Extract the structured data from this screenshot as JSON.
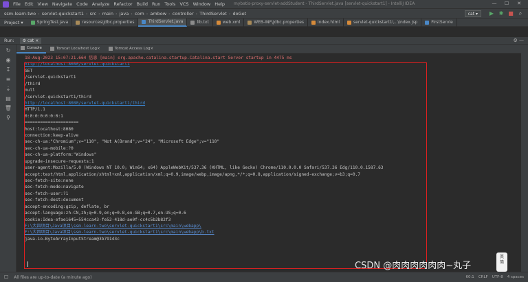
{
  "menubar": {
    "items": [
      "File",
      "Edit",
      "View",
      "Navigate",
      "Code",
      "Analyze",
      "Refactor",
      "Build",
      "Run",
      "Tools",
      "VCS",
      "Window",
      "Help"
    ],
    "window_title": "mybatis-proxy-servlet-addStudent - ThirdServlet.java [servlet-quickstart1] - IntelliJ IDEA"
  },
  "navbar": {
    "breadcrumbs": [
      "ssm-learn-two",
      "servlet-quickstart1",
      "src",
      "main",
      "java",
      "com",
      "ambow",
      "controller",
      "ThirdServlet",
      "doGet"
    ],
    "run_config": "cat"
  },
  "tabbar": {
    "project_label": "Project",
    "tabs": [
      {
        "label": "SpringTest.java",
        "color": "#59a869",
        "active": false
      },
      {
        "label": "resources\\jdbc.properties",
        "color": "#a88a59",
        "active": false
      },
      {
        "label": "ThirdServlet.java",
        "color": "#4a88c7",
        "active": true
      },
      {
        "label": "lib.txt",
        "color": "#8c8c8c",
        "active": false
      },
      {
        "label": "web.xml",
        "color": "#d78b3a",
        "active": false
      },
      {
        "label": "WEB-INF\\jdbc.properties",
        "color": "#a88a59",
        "active": false
      },
      {
        "label": "index.html",
        "color": "#d78b3a",
        "active": false
      },
      {
        "label": "servlet-quickstart1\\...\\index.jsp",
        "color": "#d78b3a",
        "active": false
      },
      {
        "label": "FirstServle",
        "color": "#4a88c7",
        "active": false
      }
    ]
  },
  "runbar": {
    "label": "Run:",
    "tab": "cat"
  },
  "consolebar": {
    "tabs": [
      "Console",
      "Tomcat Localhost Log",
      "Tomcat Access Log"
    ]
  },
  "console": {
    "lines": [
      {
        "text": "18-Aug-2023 15:07:21.664 信息 [main] org.apache.catalina.startup.Catalina.start Server startup in 4475 ms",
        "kind": "err"
      },
      {
        "text": "http://localhost:8080/servlet-quickstart1",
        "kind": "link"
      },
      {
        "text": "GET",
        "kind": "plain"
      },
      {
        "text": "/servlet-quickstart1",
        "kind": "plain"
      },
      {
        "text": "/third",
        "kind": "plain"
      },
      {
        "text": "null",
        "kind": "plain"
      },
      {
        "text": "/servlet-quickstart1/third",
        "kind": "plain"
      },
      {
        "text": "http://localhost:8080/servlet-quickstart1/third",
        "kind": "link"
      },
      {
        "text": "HTTP/1.1",
        "kind": "plain"
      },
      {
        "text": "0:0:0:0:0:0:0:1",
        "kind": "plain"
      },
      {
        "text": "=====================",
        "kind": "plain"
      },
      {
        "text": "host:localhost:8080",
        "kind": "plain"
      },
      {
        "text": "connection:keep-alive",
        "kind": "plain"
      },
      {
        "text": "sec-ch-ua:\"Chromium\";v=\"110\", \"Not A(Brand\";v=\"24\", \"Microsoft Edge\";v=\"110\"",
        "kind": "plain"
      },
      {
        "text": "sec-ch-ua-mobile:?0",
        "kind": "plain"
      },
      {
        "text": "sec-ch-ua-platform:\"Windows\"",
        "kind": "plain"
      },
      {
        "text": "upgrade-insecure-requests:1",
        "kind": "plain"
      },
      {
        "text": "user-agent:Mozilla/5.0 (Windows NT 10.0; Win64; x64) AppleWebKit/537.36 (KHTML, like Gecko) Chrome/110.0.0.0 Safari/537.36 Edg/110.0.1587.63",
        "kind": "plain"
      },
      {
        "text": "accept:text/html,application/xhtml+xml,application/xml;q=0.9,image/webp,image/apng,*/*;q=0.8,application/signed-exchange;v=b3;q=0.7",
        "kind": "plain"
      },
      {
        "text": "sec-fetch-site:none",
        "kind": "plain"
      },
      {
        "text": "sec-fetch-mode:navigate",
        "kind": "plain"
      },
      {
        "text": "sec-fetch-user:?1",
        "kind": "plain"
      },
      {
        "text": "sec-fetch-dest:document",
        "kind": "plain"
      },
      {
        "text": "accept-encoding:gzip, deflate, br",
        "kind": "plain"
      },
      {
        "text": "accept-language:zh-CN,zh;q=0.9,en;q=0.8,en-GB;q=0.7,en-US;q=0.6",
        "kind": "plain"
      },
      {
        "text": "cookie:Idea-efae1645=554cca43-fe52-418d-ae0f-cc4c5b2b82f3",
        "kind": "plain"
      },
      {
        "text": "F:\\大四项目\\Java项目\\ssm-learn-two\\servlet-quickstart1\\src\\main\\webapp\\",
        "kind": "path"
      },
      {
        "text": "F:\\大四项目\\Java项目\\ssm-learn-two\\servlet-quickstart1\\src\\main\\webapp\\b.txt",
        "kind": "path"
      },
      {
        "text": "java.io.ByteArrayInputStream@3b79143c",
        "kind": "plain"
      }
    ]
  },
  "statusbar": {
    "message": "All files are up-to-date (a minute ago)",
    "right": [
      "60:1",
      "CRLF",
      "UTF-8",
      "4 spaces"
    ]
  },
  "watermark": "CSDN @肉肉肉肉肉肉~丸子",
  "ime": {
    "line1": "英",
    "line2": "简"
  }
}
